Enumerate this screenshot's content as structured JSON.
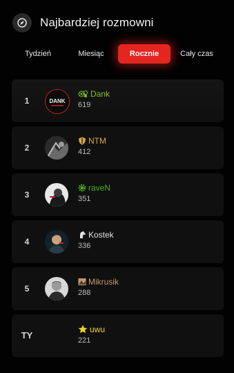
{
  "header": {
    "title": "Najbardziej rozmowni",
    "icon": "compass-icon"
  },
  "tabs": [
    {
      "label": "Tydzień",
      "active": false
    },
    {
      "label": "Miesiąc",
      "active": false
    },
    {
      "label": "Rocznie",
      "active": true
    },
    {
      "label": "Cały czas",
      "active": false
    }
  ],
  "leaderboard": [
    {
      "rank": "1",
      "name": "Dank",
      "score": "619",
      "name_color": "#7fbf2a",
      "badge": "gears-icon",
      "avatar_text": "DANK"
    },
    {
      "rank": "2",
      "name": "NTM",
      "score": "412",
      "name_color": "#d9a63f",
      "badge": "shield-icon"
    },
    {
      "rank": "3",
      "name": "raveN",
      "score": "351",
      "name_color": "#4caf1f",
      "badge": "gear-icon"
    },
    {
      "rank": "4",
      "name": "Kostek",
      "score": "336",
      "name_color": "#e0e0e0",
      "badge": "horse-head-icon"
    },
    {
      "rank": "5",
      "name": "Mikrusik",
      "score": "288",
      "name_color": "#c49a6c",
      "badge": "image-badge-icon"
    },
    {
      "rank": "TY",
      "name": "uwu",
      "score": "221",
      "name_color": "#f2d21b",
      "badge": "star-icon"
    }
  ]
}
